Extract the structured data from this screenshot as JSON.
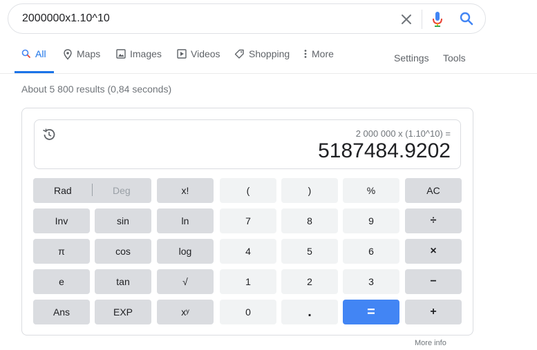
{
  "search": {
    "query": "2000000x1.10^10",
    "icons": [
      "clear-icon",
      "mic-icon",
      "search-icon"
    ]
  },
  "tabs": [
    {
      "label": "All",
      "icon": "search-icon",
      "active": true
    },
    {
      "label": "Maps",
      "icon": "map-pin-icon"
    },
    {
      "label": "Images",
      "icon": "image-icon"
    },
    {
      "label": "Videos",
      "icon": "play-icon"
    },
    {
      "label": "Shopping",
      "icon": "tag-icon"
    },
    {
      "label": "More",
      "icon": "vertical-dots-icon"
    }
  ],
  "tools": {
    "settings": "Settings",
    "tools": "Tools"
  },
  "result_stats": "About 5 800 results (0,84 seconds)",
  "calculator": {
    "expression": "2 000 000 x (1.10^10) =",
    "result": "5187484.9202",
    "rad": "Rad",
    "deg": "Deg",
    "keys": {
      "fact": "x!",
      "lparen": "(",
      "rparen": ")",
      "percent": "%",
      "ac": "AC",
      "inv": "Inv",
      "sin": "sin",
      "ln": "ln",
      "n7": "7",
      "n8": "8",
      "n9": "9",
      "div": "÷",
      "pi": "π",
      "cos": "cos",
      "log": "log",
      "n4": "4",
      "n5": "5",
      "n6": "6",
      "mul": "×",
      "e": "e",
      "tan": "tan",
      "sqrt": "√",
      "n1": "1",
      "n2": "2",
      "n3": "3",
      "minus": "−",
      "ans": "Ans",
      "exp": "EXP",
      "pow": "xʸ",
      "n0": "0",
      "dot": ".",
      "eq": "=",
      "plus": "+"
    }
  },
  "more_info": "More info",
  "colors": {
    "accent": "#1a73e8",
    "equals": "#4285f4",
    "fn_key": "#dadce0",
    "num_key": "#f1f3f4"
  }
}
